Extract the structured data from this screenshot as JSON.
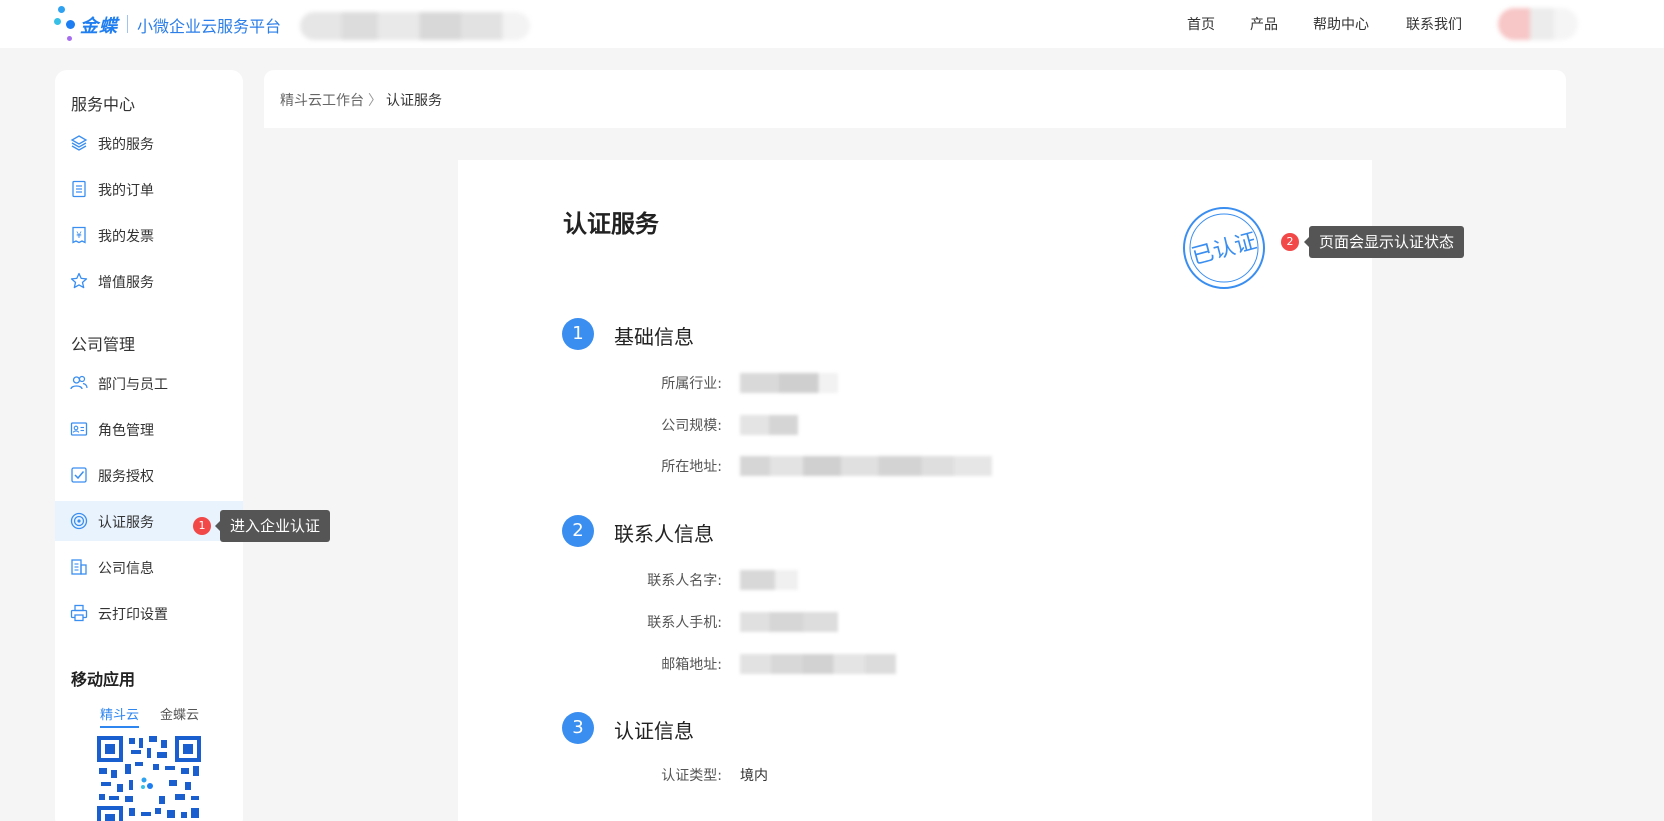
{
  "header": {
    "brand": "金蝶",
    "platform": "小微企业云服务平台",
    "nav": [
      {
        "label": "首页"
      },
      {
        "label": "产品"
      },
      {
        "label": "帮助中心"
      },
      {
        "label": "联系我们"
      }
    ]
  },
  "sidebar": {
    "service_title": "服务中心",
    "service_items": [
      {
        "label": "我的服务",
        "icon": "layers-icon"
      },
      {
        "label": "我的订单",
        "icon": "order-list-icon"
      },
      {
        "label": "我的发票",
        "icon": "invoice-icon"
      },
      {
        "label": "增值服务",
        "icon": "star-icon"
      }
    ],
    "company_title": "公司管理",
    "company_items": [
      {
        "label": "部门与员工",
        "icon": "users-icon"
      },
      {
        "label": "角色管理",
        "icon": "id-card-icon"
      },
      {
        "label": "服务授权",
        "icon": "checkbox-icon"
      },
      {
        "label": "认证服务",
        "icon": "target-icon",
        "active": true
      },
      {
        "label": "公司信息",
        "icon": "company-info-icon"
      },
      {
        "label": "云打印设置",
        "icon": "printer-icon"
      }
    ],
    "mobile_title": "移动应用",
    "mobile_tabs": [
      {
        "label": "精斗云",
        "active": true
      },
      {
        "label": "金蝶云",
        "active": false
      }
    ]
  },
  "tips": {
    "tip1": {
      "num": "1",
      "text": "进入企业认证"
    },
    "tip2": {
      "num": "2",
      "text": "页面会显示认证状态"
    }
  },
  "breadcrumb": {
    "parent": "精斗云工作台",
    "separator": "〉",
    "current": "认证服务"
  },
  "main": {
    "title": "认证服务",
    "stamp_text": "已认证",
    "sections": [
      {
        "num": "1",
        "title": "基础信息",
        "fields": [
          {
            "label": "所属行业:"
          },
          {
            "label": "公司规模:"
          },
          {
            "label": "所在地址:"
          }
        ]
      },
      {
        "num": "2",
        "title": "联系人信息",
        "fields": [
          {
            "label": "联系人名字:"
          },
          {
            "label": "联系人手机:"
          },
          {
            "label": "邮箱地址:"
          }
        ]
      },
      {
        "num": "3",
        "title": "认证信息",
        "fields": [
          {
            "label": "认证类型:",
            "value": "境内"
          }
        ]
      }
    ]
  },
  "colors": {
    "accent": "#3a8ef0",
    "badge": "#f24848",
    "tooltip": "#555555",
    "active_bg": "#e9f3fe"
  }
}
